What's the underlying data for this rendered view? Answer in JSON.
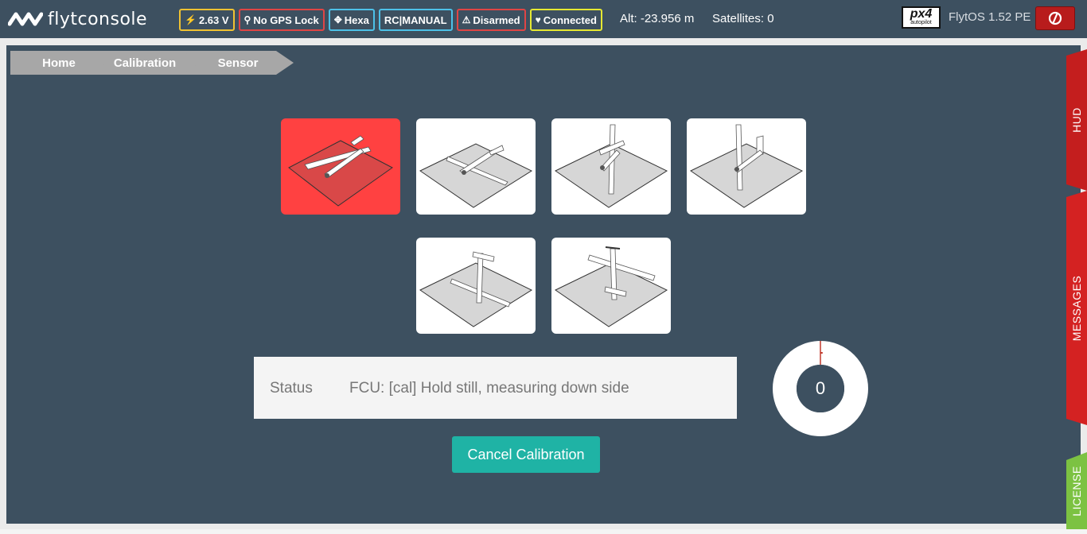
{
  "app": {
    "brand": "flytconsole"
  },
  "badges": [
    {
      "label": "2.63 V",
      "icon": "bolt-icon",
      "color": "#f0c232"
    },
    {
      "label": "No GPS Lock",
      "icon": "map-marker-icon",
      "color": "#e04545"
    },
    {
      "label": "Hexa",
      "icon": "arrows-move-icon",
      "color": "#4dc1e8"
    },
    {
      "label": "RC|MANUAL",
      "icon": "",
      "color": "#4dc1e8"
    },
    {
      "label": "Disarmed",
      "icon": "warning-icon",
      "color": "#e04545"
    },
    {
      "label": "Connected",
      "icon": "heart-icon",
      "color": "#e6e832"
    }
  ],
  "top": {
    "altitude": "Alt: -23.956 m",
    "satellites": "Satellites: 0",
    "px4_logo": "px4",
    "px4_sub": "autopilot",
    "flytos": "FlytOS 1.52 PE"
  },
  "breadcrumb": [
    "Home",
    "Calibration",
    "Sensor"
  ],
  "orientations": [
    {
      "name": "orientation-level",
      "active": true
    },
    {
      "name": "orientation-left-side",
      "active": false
    },
    {
      "name": "orientation-nose-down",
      "active": false
    },
    {
      "name": "orientation-nose-up",
      "active": false
    },
    {
      "name": "orientation-right-side",
      "active": false
    },
    {
      "name": "orientation-upside-down",
      "active": false
    }
  ],
  "status": {
    "label": "Status",
    "message": "FCU: [cal] Hold still, measuring down side"
  },
  "progress": {
    "value": "0",
    "percent": 1
  },
  "cancel_label": "Cancel Calibration",
  "side_tabs": [
    {
      "label": "HUD",
      "color": "#c41e1e"
    },
    {
      "label": "MESSAGES",
      "color": "#d42222"
    },
    {
      "label": "LICENSE",
      "color": "#7cc242"
    }
  ],
  "colors": {
    "panel": "#3d5060",
    "accent": "#1fb3a5",
    "active_tile": "#ff4141"
  }
}
